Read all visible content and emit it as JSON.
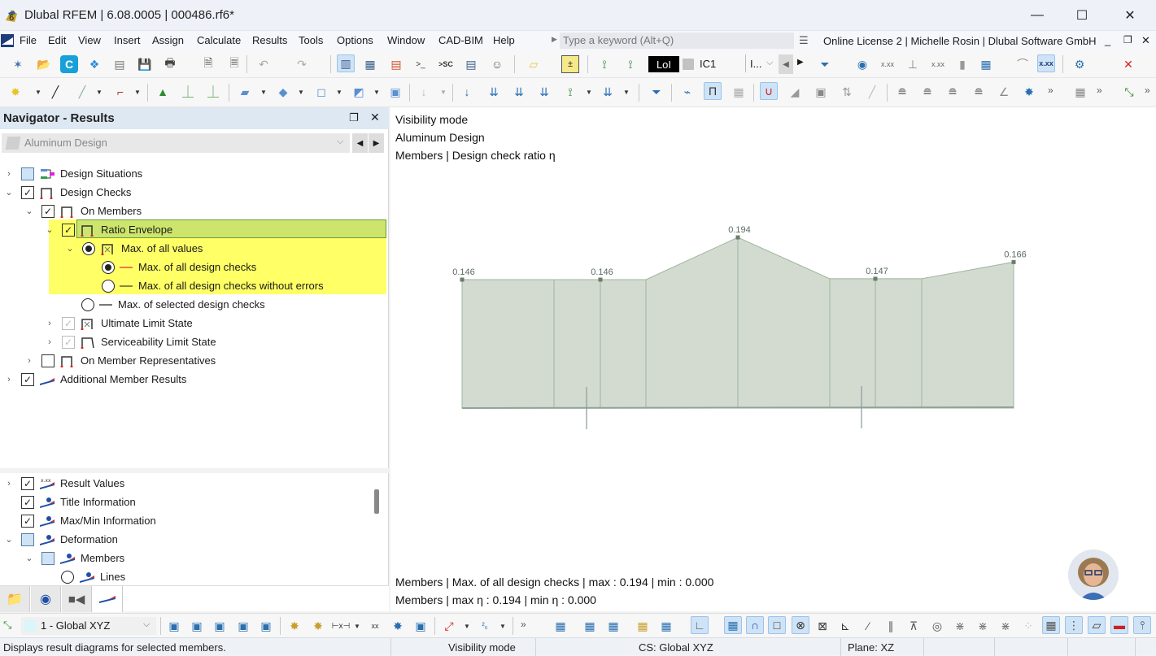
{
  "window": {
    "title": "Dlubal RFEM | 6.08.0005 | 000486.rf6*",
    "minimize": "—",
    "maximize": "☐",
    "close": "✕"
  },
  "menu": {
    "items": [
      "File",
      "Edit",
      "View",
      "Insert",
      "Assign",
      "Calculate",
      "Results",
      "Tools",
      "Options",
      "Window",
      "CAD-BIM",
      "Help"
    ],
    "search_placeholder": "Type a keyword (Alt+Q)",
    "license": "Online License 2 | Michelle Rosin | Dlubal Software GmbH"
  },
  "toolbar1": {
    "load_combo_badge": "LoI",
    "load_combo_value": "IC1",
    "load_combo_short": "I...",
    "result_values_label": "x.xx"
  },
  "navigator": {
    "title": "Navigator - Results",
    "combo_value": "Aluminum Design",
    "tree": [
      {
        "label": "Design Situations",
        "state": "partial",
        "expanded": false
      },
      {
        "label": "Design Checks",
        "state": "checked",
        "expanded": true
      },
      {
        "label": "On Members",
        "state": "checked",
        "expanded": true
      },
      {
        "label": "Ratio Envelope",
        "state": "checked",
        "expanded": true,
        "selected": true
      },
      {
        "label": "Max. of all values",
        "radio": true,
        "expanded": true
      },
      {
        "label": "Max. of all design checks",
        "radio": true,
        "line_color": "#f07a3c"
      },
      {
        "label": "Max. of all design checks without errors",
        "radio": false,
        "line_color": "#8a8a3a"
      },
      {
        "label": "Max. of selected design checks",
        "radio": false,
        "line_color": "#777777"
      },
      {
        "label": "Ultimate Limit State",
        "state": "disabled",
        "expanded": false
      },
      {
        "label": "Serviceability Limit State",
        "state": "disabled",
        "expanded": false
      },
      {
        "label": "On Member Representatives",
        "state": "unchecked",
        "expanded": false
      },
      {
        "label": "Additional Member Results",
        "state": "checked",
        "expanded": false
      }
    ],
    "tree2": [
      {
        "label": "Result Values",
        "state": "checked",
        "expanded": false
      },
      {
        "label": "Title Information",
        "state": "checked"
      },
      {
        "label": "Max/Min Information",
        "state": "checked"
      },
      {
        "label": "Deformation",
        "state": "partial",
        "expanded": true
      },
      {
        "label": "Members",
        "state": "partial",
        "expanded": true
      },
      {
        "label": "Lines",
        "radio": false
      }
    ],
    "tabs": [
      "data-tab",
      "display-tab",
      "views-tab",
      "results-tab"
    ]
  },
  "viewport": {
    "info_lines": [
      "Visibility mode",
      "Aluminum Design",
      "Members | Design check ratio η"
    ],
    "diagram_labels": [
      "0.146",
      "0.146",
      "0.194",
      "0.147",
      "0.166"
    ],
    "diagram_values": [
      0.146,
      0.146,
      0.146,
      0.194,
      0.147,
      0.147,
      0.166
    ],
    "footer_lines": [
      "Members | Max. of all design checks | max  : 0.194 | min  : 0.000",
      "Members | max η : 0.194 | min η : 0.000"
    ],
    "fill_color": "#d3dbd1",
    "stroke_color": "#9cb59c"
  },
  "bottom_toolbar": {
    "coordinate_system": "1 - Global XYZ"
  },
  "statusbar": {
    "hint": "Displays result diagrams for selected members.",
    "mode": "Visibility mode",
    "cs": "CS: Global XYZ",
    "plane": "Plane: XZ"
  }
}
